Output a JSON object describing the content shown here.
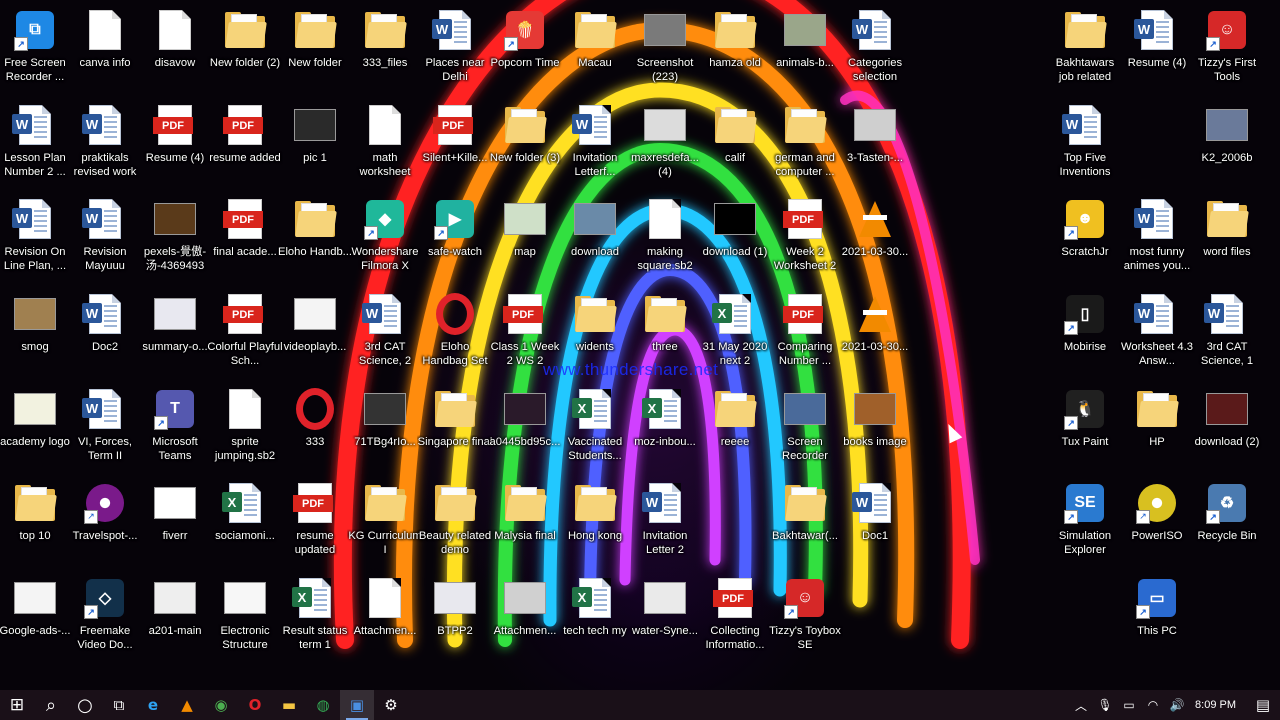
{
  "desktop": {
    "watermark": "www.thundershare.net",
    "icons": [
      {
        "label": "Free Screen Recorder ...",
        "type": "app",
        "color": "#1e88e5",
        "glyph": "⧉"
      },
      {
        "label": "canva info",
        "type": "blank"
      },
      {
        "label": "disavow",
        "type": "blank"
      },
      {
        "label": "New folder (2)",
        "type": "folder"
      },
      {
        "label": "New folder",
        "type": "folder"
      },
      {
        "label": "333_files",
        "type": "folder"
      },
      {
        "label": "Places near Delhi",
        "type": "word"
      },
      {
        "label": "Popcorn Time",
        "type": "app",
        "color": "#e53935",
        "glyph": "🍿"
      },
      {
        "label": "Macau",
        "type": "folder"
      },
      {
        "label": "Screenshot (223)",
        "type": "thumb",
        "color": "#7a7a7a"
      },
      {
        "label": "hamza old",
        "type": "folder"
      },
      {
        "label": "animals-b...",
        "type": "thumb",
        "color": "#9aa68a"
      },
      {
        "label": "Categories selection",
        "type": "word"
      },
      {
        "label": "Lesson Plan Number 2 ...",
        "type": "word"
      },
      {
        "label": "praktikals revised work",
        "type": "word"
      },
      {
        "label": "Resume (4)",
        "type": "pdf"
      },
      {
        "label": "resume added",
        "type": "pdf"
      },
      {
        "label": "pic 1",
        "type": "thumb",
        "color": "#2a2a2a"
      },
      {
        "label": "math worksheet",
        "type": "blank"
      },
      {
        "label": "Silent+Kille...",
        "type": "pdf"
      },
      {
        "label": "New folder (3)",
        "type": "folder"
      },
      {
        "label": "Invitation Letterf...",
        "type": "word"
      },
      {
        "label": "maxresdefa... (4)",
        "type": "thumb",
        "color": "#dcdcdc"
      },
      {
        "label": "calif",
        "type": "folder"
      },
      {
        "label": "german and computer ...",
        "type": "folder"
      },
      {
        "label": "3-Tasten-...",
        "type": "thumb",
        "color": "#cfcfcf"
      },
      {
        "label": "Revision On Line Plan, ...",
        "type": "word"
      },
      {
        "label": "Revision Mayuuu",
        "type": "word"
      },
      {
        "label": "pexels-覺傲-汤-4369493",
        "type": "thumb",
        "color": "#5a3a1a"
      },
      {
        "label": "final acade...",
        "type": "pdf"
      },
      {
        "label": "Eloho Handb...",
        "type": "folder"
      },
      {
        "label": "Wondershare Filmora X",
        "type": "app",
        "color": "#1fb89a",
        "glyph": "◆"
      },
      {
        "label": "safe-watch",
        "type": "app",
        "color": "#20b2a0",
        "glyph": "▶"
      },
      {
        "label": "map",
        "type": "thumb",
        "color": "#cfe0c8"
      },
      {
        "label": "download",
        "type": "thumb",
        "color": "#6a8aa8"
      },
      {
        "label": "making square.sb2",
        "type": "blank"
      },
      {
        "label": "download (1)",
        "type": "thumb",
        "color": "#000000"
      },
      {
        "label": "Week 2 Worksheet 2",
        "type": "pdf"
      },
      {
        "label": "2021-03-30...",
        "type": "vlc"
      },
      {
        "label": "smog",
        "type": "thumb",
        "color": "#a08050"
      },
      {
        "label": "Doc2",
        "type": "word"
      },
      {
        "label": "summary-o...",
        "type": "thumb",
        "color": "#e8e8f0"
      },
      {
        "label": "Colorful Playful Sch...",
        "type": "pdf"
      },
      {
        "label": "videoplayb...",
        "type": "thumb",
        "color": "#f4f4f4"
      },
      {
        "label": "3rd CAT Science, 2",
        "type": "word"
      },
      {
        "label": "Eloho Handbag Set",
        "type": "opera"
      },
      {
        "label": "Class 1 Week 2 WS 2",
        "type": "pdf"
      },
      {
        "label": "widents",
        "type": "folder"
      },
      {
        "label": "three",
        "type": "folder"
      },
      {
        "label": "31 May 2020 next 2",
        "type": "excel"
      },
      {
        "label": "Comparing Number ...",
        "type": "pdf"
      },
      {
        "label": "2021-03-30...",
        "type": "vlc"
      },
      {
        "label": "academy logo",
        "type": "thumb",
        "color": "#f2f2e0"
      },
      {
        "label": "VI, Forces, Term II",
        "type": "word"
      },
      {
        "label": "Microsoft Teams",
        "type": "app",
        "color": "#5558af",
        "glyph": "T"
      },
      {
        "label": "sprite jumping.sb2",
        "type": "blank"
      },
      {
        "label": "333",
        "type": "opera"
      },
      {
        "label": "71TBg4rIo...",
        "type": "thumb",
        "color": "#333333"
      },
      {
        "label": "Singapore final",
        "type": "folder"
      },
      {
        "label": "a0445bd95c...",
        "type": "thumb",
        "color": "#2a1a2a"
      },
      {
        "label": "Vaccinated Students...",
        "type": "excel"
      },
      {
        "label": "moz-inbou...",
        "type": "excel"
      },
      {
        "label": "reeee",
        "type": "folder"
      },
      {
        "label": "Screen Recorder",
        "type": "thumb",
        "color": "#4a6a9a"
      },
      {
        "label": "books image",
        "type": "thumb",
        "color": "#a0602a"
      },
      {
        "label": "top 10",
        "type": "folder"
      },
      {
        "label": "Travelspot-...",
        "type": "round",
        "color": "#7a1a8a"
      },
      {
        "label": "fiverr",
        "type": "thumb",
        "color": "#ffffff"
      },
      {
        "label": "sociamoni...",
        "type": "excel"
      },
      {
        "label": "resume updated",
        "type": "pdf"
      },
      {
        "label": "KG Curriculum I",
        "type": "folder"
      },
      {
        "label": "Beauty related demo",
        "type": "folder"
      },
      {
        "label": "Malysia final",
        "type": "folder"
      },
      {
        "label": "Hong kong",
        "type": "folder"
      },
      {
        "label": "Invitation Letter 2",
        "type": "word"
      },
      {
        "label": "Bakhtawar(...",
        "type": "folder"
      },
      {
        "label": "Doc1",
        "type": "word"
      },
      {
        "label": "Google-ads-...",
        "type": "thumb",
        "color": "#f4f4f4"
      },
      {
        "label": "Freemake Video Do...",
        "type": "app",
        "color": "#12304a",
        "glyph": "◇"
      },
      {
        "label": "a201-main",
        "type": "thumb",
        "color": "#eeeeee"
      },
      {
        "label": "Electronic Structure",
        "type": "thumb",
        "color": "#f7f7f7"
      },
      {
        "label": "Result status term 1",
        "type": "excel"
      },
      {
        "label": "Attachmen...",
        "type": "blank"
      },
      {
        "label": "BTPP2",
        "type": "thumb",
        "color": "#e8e8ee"
      },
      {
        "label": "Attachmen...",
        "type": "thumb",
        "color": "#d0d0d0"
      },
      {
        "label": "tech tech my",
        "type": "excel"
      },
      {
        "label": "water-Syne...",
        "type": "thumb",
        "color": "#eaeaea"
      },
      {
        "label": "Collecting Informatio...",
        "type": "pdf"
      },
      {
        "label": "Tizzy's Toybox SE",
        "type": "app",
        "color": "#d62828",
        "glyph": "☺"
      },
      {
        "label": "Bakhtawars job related",
        "type": "folder"
      },
      {
        "label": "Resume (4)",
        "type": "word"
      },
      {
        "label": "Tizzy's First Tools",
        "type": "app",
        "color": "#d62828",
        "glyph": "☺"
      },
      {
        "label": "Top Five Inventions",
        "type": "word"
      },
      {
        "label": "K2_2006b",
        "type": "thumb",
        "color": "#6a7a9a"
      },
      {
        "label": "ScratchJr",
        "type": "app",
        "color": "#f0c020",
        "glyph": "☻"
      },
      {
        "label": "most funny animes you...",
        "type": "word"
      },
      {
        "label": "word files",
        "type": "folder"
      },
      {
        "label": "Mobirise",
        "type": "app",
        "color": "#1a1a1a",
        "glyph": "▯"
      },
      {
        "label": "Worksheet 4.3 Answ...",
        "type": "word"
      },
      {
        "label": "3rd CAT Science, 1",
        "type": "word"
      },
      {
        "label": "Tux Paint",
        "type": "app",
        "color": "#202020",
        "glyph": "🐧"
      },
      {
        "label": "HP",
        "type": "folder"
      },
      {
        "label": "download (2)",
        "type": "thumb",
        "color": "#5a1a1a"
      },
      {
        "label": "Simulation Explorer",
        "type": "app",
        "color": "#2a7ad0",
        "glyph": "SE"
      },
      {
        "label": "PowerISO",
        "type": "round",
        "color": "#d8c020"
      },
      {
        "label": "Recycle Bin",
        "type": "app",
        "color": "#4a7ab0",
        "glyph": "♻"
      },
      {
        "label": "This PC",
        "type": "app",
        "color": "#2a6ad0",
        "glyph": "▭"
      }
    ]
  },
  "taskbar": {
    "start_glyph": "⊞",
    "search_glyph": "⌕",
    "cortana_glyph": "○",
    "taskview_glyph": "⧉",
    "pinned": [
      {
        "name": "edge",
        "glyph": "e",
        "color": "#2ea3f2"
      },
      {
        "name": "vlc",
        "glyph": "▲",
        "color": "#f28a00"
      },
      {
        "name": "app-green",
        "glyph": "◉",
        "color": "#4caf50"
      },
      {
        "name": "opera",
        "glyph": "O",
        "color": "#e0222a"
      },
      {
        "name": "file-explorer",
        "glyph": "▬",
        "color": "#f4c542"
      },
      {
        "name": "chrome",
        "glyph": "◍",
        "color": "#34a853"
      },
      {
        "name": "screen-recorder",
        "glyph": "▣",
        "color": "#4a90e2"
      },
      {
        "name": "settings",
        "glyph": "⚙",
        "color": "#ffffff"
      }
    ],
    "tray": {
      "chevron": "︿",
      "mic": "🎙",
      "battery": "▭",
      "wifi": "◠",
      "volume": "🔊",
      "time": "8:09 PM",
      "notifications": "▤"
    }
  }
}
